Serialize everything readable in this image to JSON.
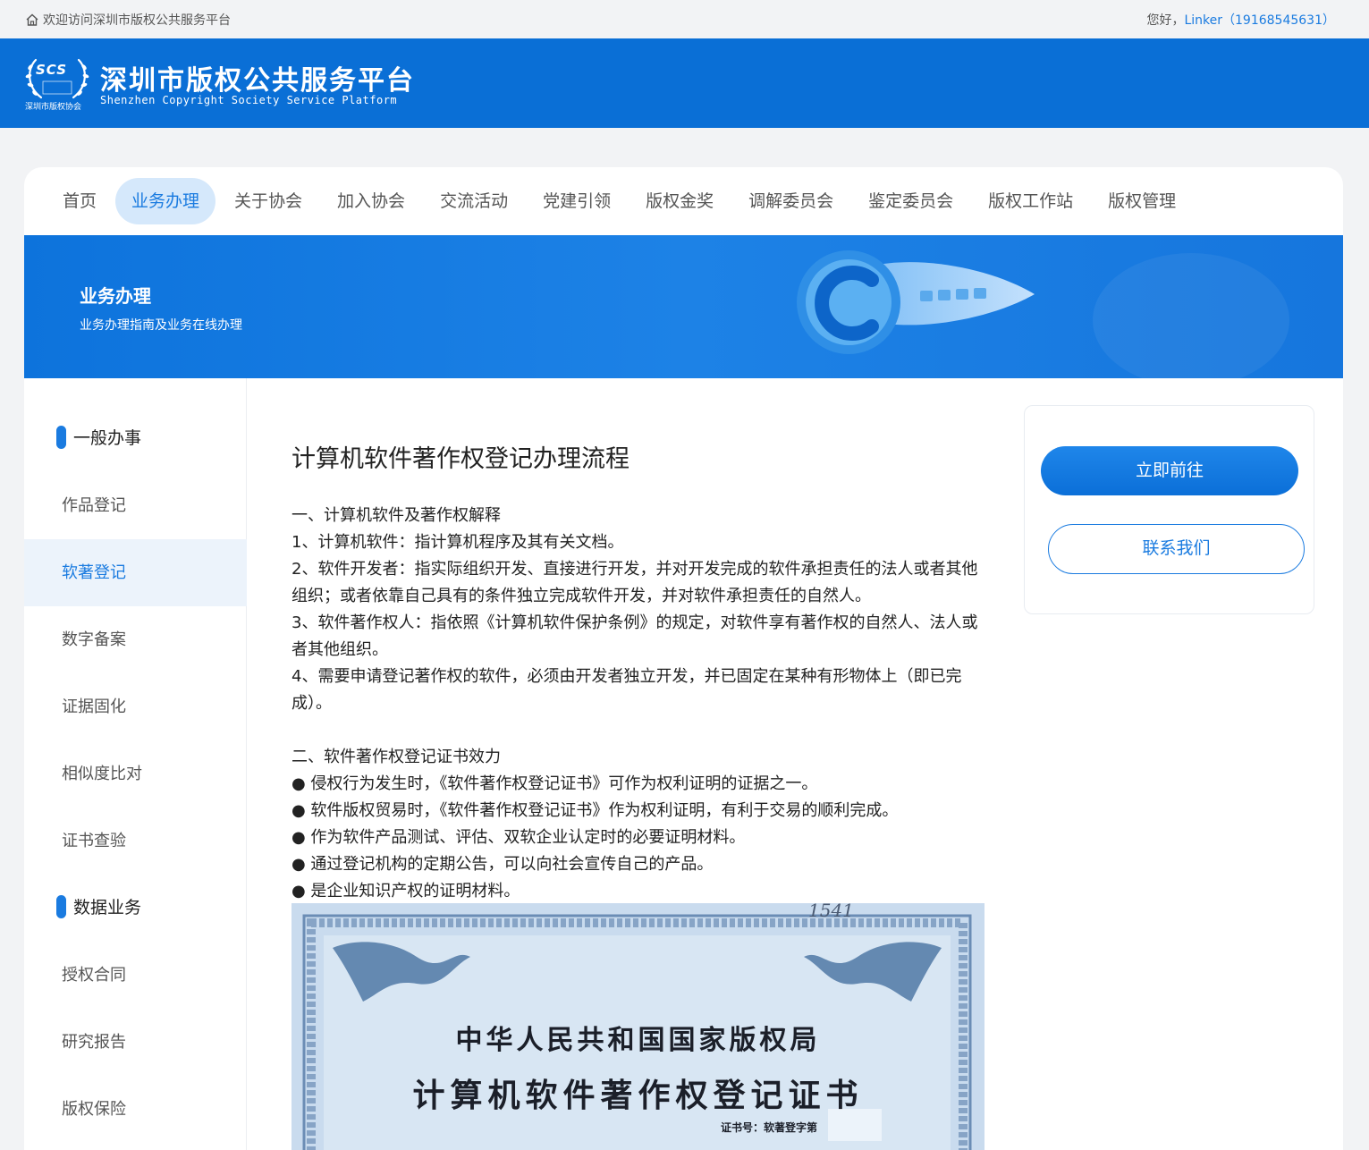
{
  "topbar": {
    "welcome": "欢迎访问深圳市版权公共服务平台",
    "greeting_prefix": "您好，",
    "user": "Linker（19168545631）"
  },
  "header": {
    "logo_text": "SCS",
    "logo_assoc": "深圳市版权协会",
    "title": "深圳市版权公共服务平台",
    "subtitle": "Shenzhen Copyright Society Service Platform"
  },
  "nav": {
    "items": [
      {
        "label": "首页"
      },
      {
        "label": "业务办理"
      },
      {
        "label": "关于协会"
      },
      {
        "label": "加入协会"
      },
      {
        "label": "交流活动"
      },
      {
        "label": "党建引领"
      },
      {
        "label": "版权金奖"
      },
      {
        "label": "调解委员会"
      },
      {
        "label": "鉴定委员会"
      },
      {
        "label": "版权工作站"
      },
      {
        "label": "版权管理"
      }
    ],
    "active_index": 1
  },
  "banner": {
    "title": "业务办理",
    "subtitle": "业务办理指南及业务在线办理"
  },
  "sidebar": {
    "group1": "一般办事",
    "group1_items": [
      "作品登记",
      "软著登记",
      "数字备案",
      "证据固化",
      "相似度比对",
      "证书查验"
    ],
    "group2": "数据业务",
    "group2_items": [
      "授权合同",
      "研究报告",
      "版权保险"
    ],
    "active_item": "软著登记"
  },
  "article": {
    "title": "计算机软件著作权登记办理流程",
    "section1_heading": "一、计算机软件及著作权解释",
    "section1": [
      "1、计算机软件：指计算机程序及其有关文档。",
      "2、软件开发者：指实际组织开发、直接进行开发，并对开发完成的软件承担责任的法人或者其他组织；或者依靠自己具有的条件独立完成软件开发，并对软件承担责任的自然人。",
      "3、软件著作权人：指依照《计算机软件保护条例》的规定，对软件享有著作权的自然人、法人或者其他组织。",
      "4、需要申请登记著作权的软件，必须由开发者独立开发，并已固定在某种有形物体上（即已完成）。"
    ],
    "section2_heading": "二、软件著作权登记证书效力",
    "section2": [
      "● 侵权行为发生时，《软件著作权登记证书》可作为权利证明的证据之一。",
      "● 软件版权贸易时，《软件著作权登记证书》作为权利证明，有利于交易的顺利完成。",
      "● 作为软件产品测试、评估、双软企业认定时的必要证明材料。",
      "● 通过登记机构的定期公告，可以向社会宣传自己的产品。",
      "● 是企业知识产权的证明材料。"
    ],
    "certificate": {
      "handwriting": "1541",
      "issuer": "中华人民共和国国家版权局",
      "name": "计算机软件著作权登记证书",
      "number_label": "证书号：软著登字第"
    }
  },
  "actions": {
    "go_now": "立即前往",
    "contact": "联系我们"
  },
  "colors": {
    "brand_blue": "#0a6fd6",
    "accent": "#1a7be0",
    "nav_active_bg": "#d5e8fb",
    "sidebar_active_bg": "#ecf3fb"
  }
}
